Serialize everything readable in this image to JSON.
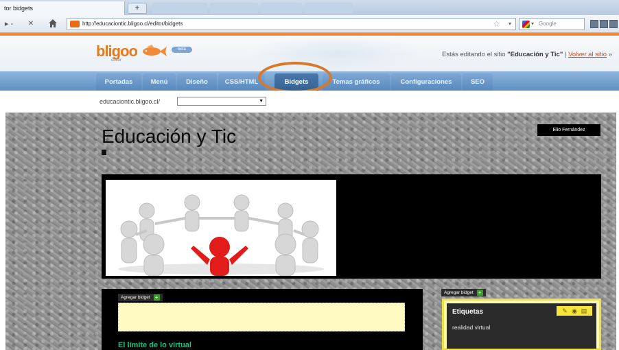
{
  "browser": {
    "tab_title": "tor bidgets",
    "new_tab": "+",
    "url": "http://educaciontic.bligoo.cl/editor/bidgets",
    "search_placeholder": "Google",
    "back": "▸ -",
    "stop": "✕",
    "bookmark_icon": "star-icon",
    "search_engine_icon": "google-icon"
  },
  "editor": {
    "logo": "bligoo",
    "logo_sub": "editor",
    "badge": "beta",
    "editing_prefix": "Estás editando el sitio ",
    "site_name_quoted": "\"Educación y Tic\"",
    "separator": " | ",
    "back_link": "Volver al sitio",
    "back_arrow": " »",
    "accent_color": "#e67a1e",
    "highlight_color": "#d9782a"
  },
  "menu": {
    "tabs": [
      {
        "label": "Portadas"
      },
      {
        "label": "Menú"
      },
      {
        "label": "Diseño"
      },
      {
        "label": "CSS/HTML"
      },
      {
        "label": "Bidgets",
        "active": true
      },
      {
        "label": "Temas gráficos"
      },
      {
        "label": "Configuraciones"
      },
      {
        "label": "SEO"
      }
    ]
  },
  "site_selector": {
    "label": "educaciontic.bligoo.cl/",
    "value": ""
  },
  "page": {
    "site_title": "Educación y Tic",
    "author": "Elio Fernández",
    "add_bidget": "Agregar bidget",
    "post_title": "El límite de lo virtual",
    "sidebar_widget": {
      "title": "Etiquetas",
      "items": [
        "realidad virtual"
      ]
    }
  }
}
